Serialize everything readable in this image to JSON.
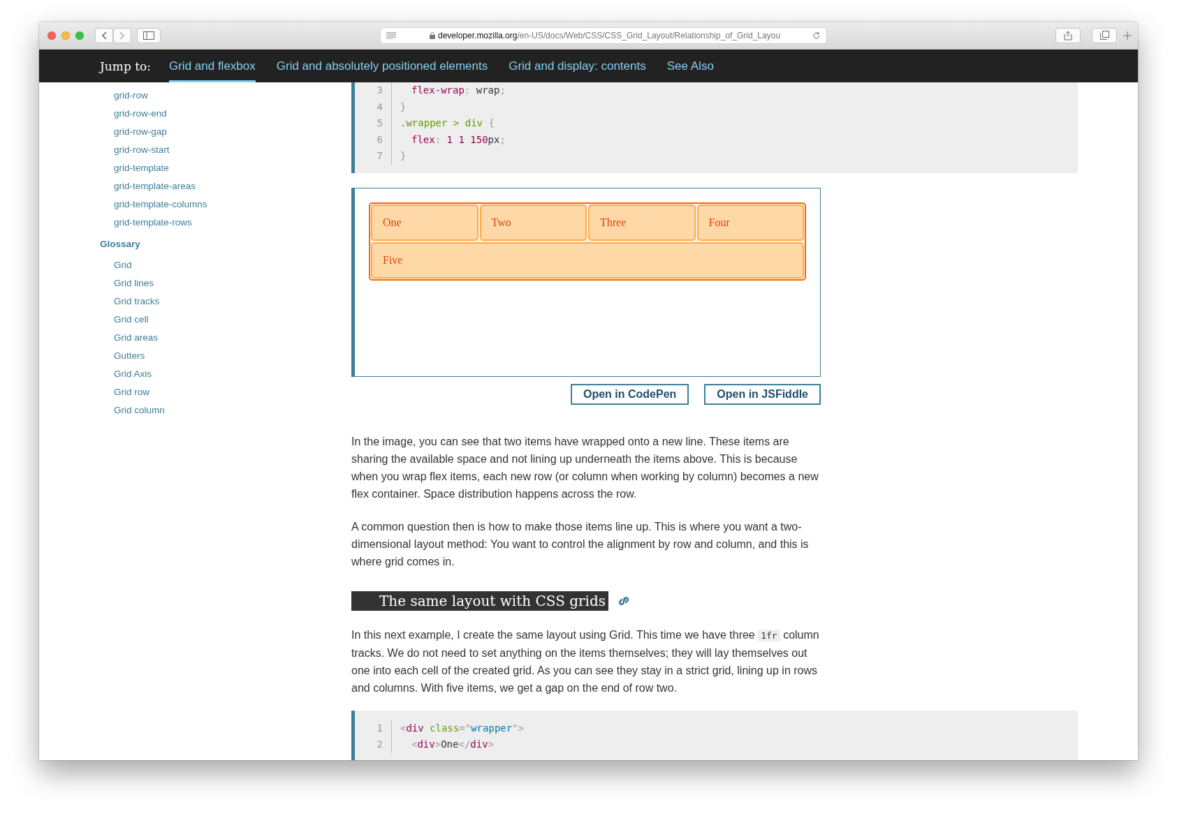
{
  "browser": {
    "url_host": "developer.mozilla.org",
    "url_path": "/en-US/docs/Web/CSS/CSS_Grid_Layout/Relationship_of_Grid_Layou"
  },
  "jump_bar": {
    "label": "Jump to:",
    "links": [
      {
        "label": "Grid and flexbox",
        "selected": true
      },
      {
        "label": "Grid and absolutely positioned elements",
        "selected": false
      },
      {
        "label": "Grid and display: contents",
        "selected": false
      },
      {
        "label": "See Also",
        "selected": false
      }
    ]
  },
  "sidebar": {
    "properties": [
      "grid-row",
      "grid-row-end",
      "grid-row-gap",
      "grid-row-start",
      "grid-template",
      "grid-template-areas",
      "grid-template-columns",
      "grid-template-rows"
    ],
    "glossary_title": "Glossary",
    "glossary": [
      "Grid",
      "Grid lines",
      "Grid tracks",
      "Grid cell",
      "Grid areas",
      "Gutters",
      "Grid Axis",
      "Grid row",
      "Grid column"
    ]
  },
  "code_block_1": {
    "lines": [
      {
        "number": "3",
        "indented": true,
        "tokens": [
          {
            "kind": "prop",
            "text": "flex-wrap"
          },
          {
            "kind": "punct",
            "text": ": "
          },
          {
            "kind": "plain",
            "text": "wrap"
          },
          {
            "kind": "punct",
            "text": ";"
          }
        ]
      },
      {
        "number": "4",
        "tokens": [
          {
            "kind": "punct",
            "text": "}"
          }
        ]
      },
      {
        "number": "5",
        "tokens": [
          {
            "kind": "selector",
            "text": ".wrapper > div"
          },
          {
            "kind": "punct",
            "text": " {"
          }
        ]
      },
      {
        "number": "6",
        "indented": true,
        "tokens": [
          {
            "kind": "prop",
            "text": "flex"
          },
          {
            "kind": "punct",
            "text": ": "
          },
          {
            "kind": "prop",
            "text": "1 1 150"
          },
          {
            "kind": "plain",
            "text": "px"
          },
          {
            "kind": "punct",
            "text": ";"
          }
        ]
      },
      {
        "number": "7",
        "tokens": [
          {
            "kind": "punct",
            "text": "}"
          }
        ]
      }
    ]
  },
  "demo": {
    "items": [
      {
        "label": "One",
        "wide": false
      },
      {
        "label": "Two",
        "wide": false
      },
      {
        "label": "Three",
        "wide": false
      },
      {
        "label": "Four",
        "wide": false
      },
      {
        "label": "Five",
        "wide": true
      }
    ],
    "buttons": [
      "Open in CodePen",
      "Open in JSFiddle"
    ]
  },
  "paragraphs": [
    {
      "parts": [
        {
          "kind": "text",
          "text": "In the image, you can see that two items have wrapped onto a new line. These items are sharing the available space and not lining up underneath the items above. This is because when you wrap flex items, each new row (or column when working by column) becomes a new flex container. Space distribution happens across the row."
        }
      ]
    },
    {
      "parts": [
        {
          "kind": "text",
          "text": "A common question then is how to make those items line up. This is where you want a two-dimensional layout method: You want to control the alignment by row and column, and this is where grid comes in."
        }
      ]
    }
  ],
  "heading": "The same layout with CSS grids",
  "paragraphs_2": [
    {
      "parts": [
        {
          "kind": "text",
          "text": "In this next example, I create the same layout using Grid. This time we have three "
        },
        {
          "kind": "code",
          "text": "1fr"
        },
        {
          "kind": "text",
          "text": " column tracks. We do not need to set anything on the items themselves; they will lay themselves out one into each cell of the created grid. As you can see they stay in a strict grid, lining up in rows and columns. With five items, we get a gap on the end of row two."
        }
      ]
    }
  ],
  "code_block_2": {
    "lines": [
      {
        "number": "1",
        "tokens": [
          {
            "kind": "punct",
            "text": "<"
          },
          {
            "kind": "tag",
            "text": "div"
          },
          {
            "kind": "selector",
            "text": " class"
          },
          {
            "kind": "punct",
            "text": "=\""
          },
          {
            "kind": "string",
            "text": "wrapper"
          },
          {
            "kind": "punct",
            "text": "\">"
          }
        ]
      },
      {
        "number": "2",
        "indented": true,
        "tokens": [
          {
            "kind": "punct",
            "text": "<"
          },
          {
            "kind": "tag",
            "text": "div"
          },
          {
            "kind": "punct",
            "text": ">"
          },
          {
            "kind": "plain",
            "text": "One"
          },
          {
            "kind": "punct",
            "text": "</"
          },
          {
            "kind": "tag",
            "text": "div"
          },
          {
            "kind": "punct",
            "text": ">"
          }
        ]
      }
    ]
  }
}
